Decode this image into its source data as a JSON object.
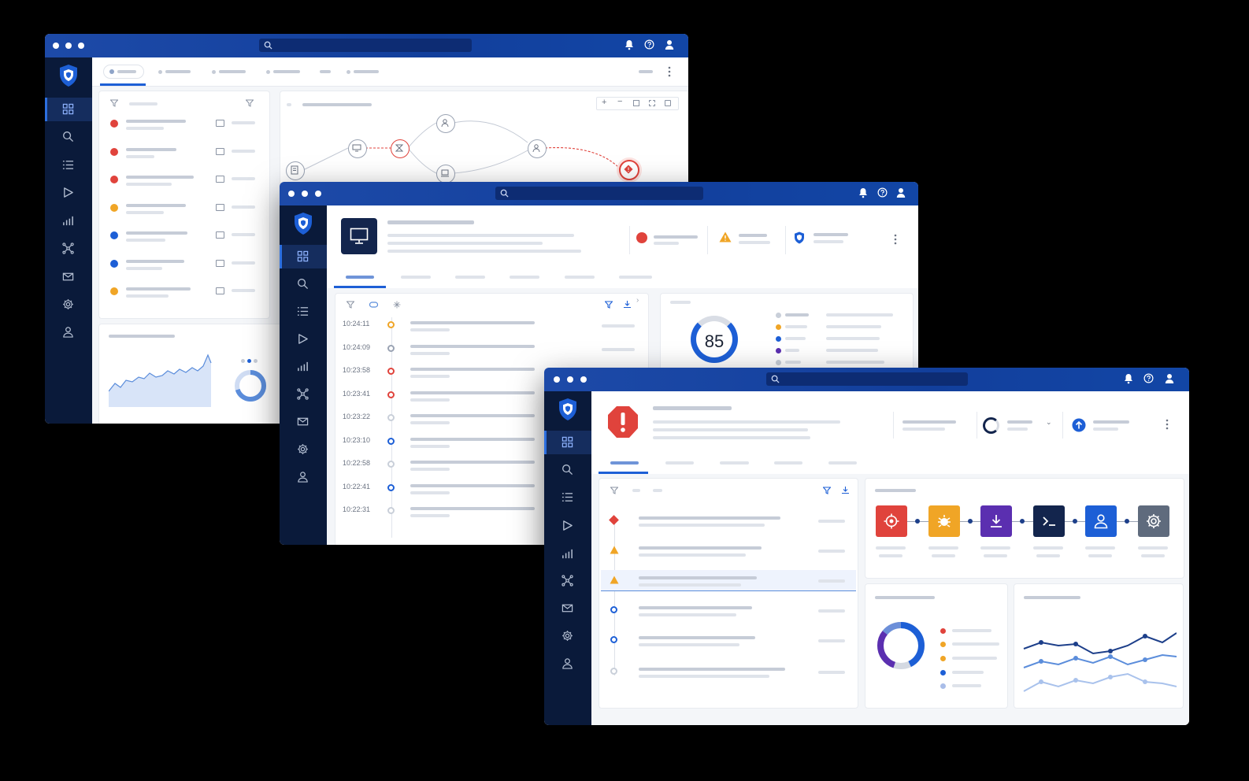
{
  "score_panel": {
    "value": "85"
  },
  "events": {
    "times": [
      "10:24:11",
      "10:24:09",
      "10:23:58",
      "10:23:41",
      "10:23:22",
      "10:23:10",
      "10:22:58",
      "10:22:41",
      "10:22:31"
    ]
  },
  "colors": {
    "titlebar": "#1346a8",
    "sidebar": "#0a1a3a",
    "accent": "#1d5fd6",
    "critical": "#e0433c",
    "warning": "#f0a526",
    "info": "#1d5fd6",
    "purple": "#5b2fb0",
    "navy": "#13254d",
    "gray": "#5f6b7d"
  },
  "icons": {
    "sidebar": [
      "dashboard-icon",
      "search-icon",
      "list-icon",
      "play-icon",
      "chart-icon",
      "network-icon",
      "mail-icon",
      "gear-icon",
      "user-icon"
    ],
    "titlebar": [
      "bell-icon",
      "help-icon",
      "user-icon"
    ],
    "kill_chain": [
      "target-icon",
      "bug-icon",
      "download-icon",
      "terminal-icon",
      "user-icon",
      "gear-icon"
    ]
  }
}
